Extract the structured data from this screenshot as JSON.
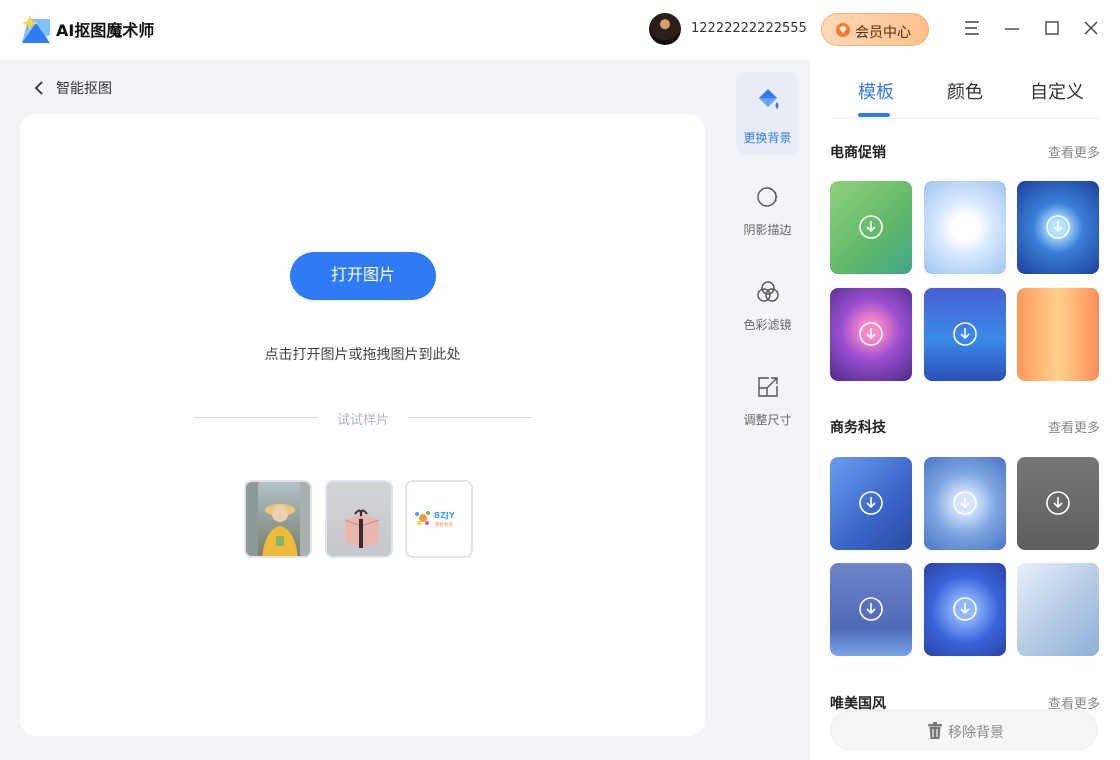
{
  "app": {
    "title": "AI抠图魔术师"
  },
  "user": {
    "name": "12222222222555",
    "vip_label": "会员中心"
  },
  "window_controls": [
    "menu-icon",
    "minimize-icon",
    "maximize-icon",
    "close-icon"
  ],
  "breadcrumb": {
    "label": "智能抠图"
  },
  "workspace": {
    "open_button": "打开图片",
    "hint": "点击打开图片或拖拽图片到此处",
    "samples_label": "试试样片",
    "samples": [
      "sample-portrait",
      "sample-gift-box",
      "sample-logo"
    ],
    "logo_sample_text": {
      "brand": "BZJY",
      "sub": "帮智有易"
    }
  },
  "tools": [
    {
      "label": "更换背景",
      "icon": "paint-bucket-icon",
      "active": true
    },
    {
      "label": "阴影描边",
      "icon": "shadow-outline-icon",
      "active": false
    },
    {
      "label": "色彩滤镜",
      "icon": "color-filter-icon",
      "active": false
    },
    {
      "label": "调整尺寸",
      "icon": "resize-icon",
      "active": false
    }
  ],
  "panel": {
    "tabs": [
      "模板",
      "颜色",
      "自定义"
    ],
    "active_tab": "模板",
    "sections": [
      {
        "title": "电商促销",
        "more": "查看更多"
      },
      {
        "title": "商务科技",
        "more": "查看更多"
      },
      {
        "title": "唯美国风",
        "more": "查看更多"
      }
    ],
    "remove_button": "移除背景"
  },
  "colors": {
    "accent": "#2f7bf6",
    "vip_gradient_start": "#ffd9b8",
    "vip_gradient_end": "#ffc08c"
  }
}
